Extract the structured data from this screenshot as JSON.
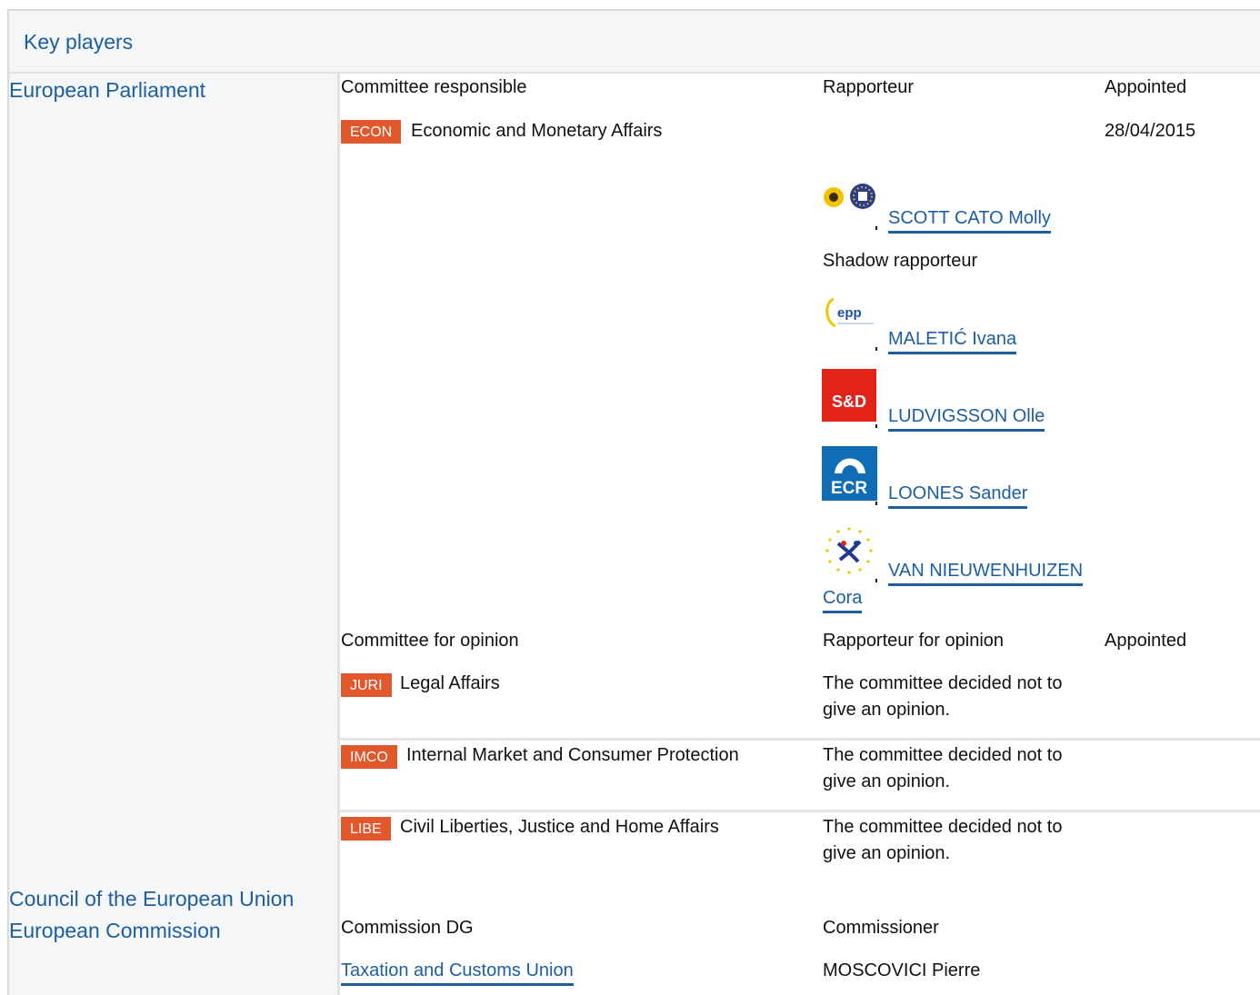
{
  "header": {
    "title": "Key players"
  },
  "institutions": {
    "ep": "European Parliament",
    "council": "Council of the European Union",
    "commission": "European Commission"
  },
  "responsible": {
    "col_committee": "Committee responsible",
    "col_rapporteur": "Rapporteur",
    "col_appointed": "Appointed",
    "badge": "ECON",
    "name": "Economic and Monetary Affairs",
    "appointed": "28/04/2015",
    "rapporteur": "SCOTT CATO Molly",
    "shadow_label": "Shadow rapporteur",
    "shadows": [
      {
        "name": "MALETIĆ Ivana"
      },
      {
        "name": "LUDVIGSSON Olle"
      },
      {
        "name": "LOONES Sander"
      },
      {
        "name_line1": "VAN NIEUWENHUIZEN",
        "name_line2": "Cora"
      }
    ]
  },
  "opinion": {
    "col_committee": "Committee for opinion",
    "col_rapporteur": "Rapporteur for opinion",
    "col_appointed": "Appointed",
    "rows": [
      {
        "badge": "JURI",
        "name": "Legal Affairs",
        "decision": "The committee decided not to give an opinion."
      },
      {
        "badge": "IMCO",
        "name": "Internal Market and Consumer Protection",
        "decision": "The committee decided not to give an opinion."
      },
      {
        "badge": "LIBE",
        "name": "Civil Liberties, Justice and Home Affairs",
        "decision": "The committee decided not to give an opinion."
      }
    ]
  },
  "commission": {
    "col_dg": "Commission DG",
    "col_commissioner": "Commissioner",
    "dg": "Taxation and Customs Union",
    "commissioner": "MOSCOVICI Pierre"
  },
  "logos": {
    "greens": "greens-efa-logo",
    "epp": "epp-logo",
    "sd": "s-and-d-logo",
    "ecr": "ecr-logo",
    "alde": "alde-logo"
  },
  "colors": {
    "link": "#1c5ea1",
    "badge": "#e0582b",
    "panel": "#f5f6f8",
    "sd_red": "#e2231a",
    "ecr_blue": "#0f6cb5"
  }
}
